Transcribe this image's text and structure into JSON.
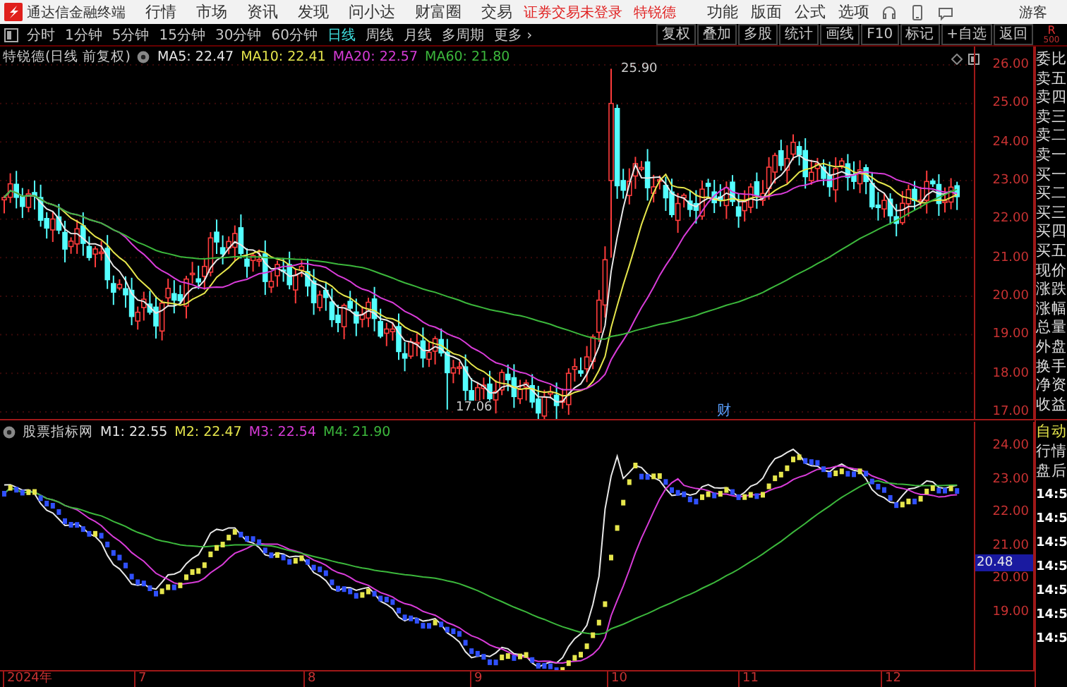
{
  "app_bar": {
    "title": "通达信金融终端",
    "menus": [
      "行情",
      "市场",
      "资讯",
      "发现",
      "问小达",
      "财富圈",
      "交易"
    ],
    "login_notice": "证券交易未登录",
    "stock_name": "特锐德",
    "tools": [
      "功能",
      "版面",
      "公式",
      "选项"
    ],
    "user": "游客"
  },
  "toolbar": {
    "periods": [
      {
        "label": "分时",
        "selected": false
      },
      {
        "label": "1分钟",
        "selected": false
      },
      {
        "label": "5分钟",
        "selected": false
      },
      {
        "label": "15分钟",
        "selected": false
      },
      {
        "label": "30分钟",
        "selected": false
      },
      {
        "label": "60分钟",
        "selected": false
      },
      {
        "label": "日线",
        "selected": true
      },
      {
        "label": "周线",
        "selected": false
      },
      {
        "label": "月线",
        "selected": false
      },
      {
        "label": "多周期",
        "selected": false
      },
      {
        "label": "更多 ›",
        "selected": false
      }
    ],
    "actions": [
      "复权",
      "叠加",
      "多股",
      "统计",
      "画线",
      "F10",
      "标记",
      "+自选",
      "返回"
    ],
    "corner": [
      "R",
      "500"
    ]
  },
  "main_chart": {
    "title": "特锐德(日线 前复权)",
    "indicators": [
      {
        "label": "MA5: 22.47",
        "color": "#e8e8e8"
      },
      {
        "label": "MA10: 22.41",
        "color": "#e6e64c"
      },
      {
        "label": "MA20: 22.57",
        "color": "#d93cd9"
      },
      {
        "label": "MA60: 21.80",
        "color": "#3cb83c"
      }
    ],
    "y_axis": [
      "26.00",
      "25.00",
      "24.00",
      "23.00",
      "22.00",
      "21.00",
      "20.00",
      "19.00",
      "18.00",
      "17.00"
    ],
    "high_label": "25.90",
    "low_label": "17.06",
    "marker": "财"
  },
  "sub_chart": {
    "title": "股票指标网",
    "indicators": [
      {
        "label": "M1: 22.55",
        "color": "#e8e8e8"
      },
      {
        "label": "M2: 22.47",
        "color": "#e6e64c"
      },
      {
        "label": "M3: 22.54",
        "color": "#d93cd9"
      },
      {
        "label": "M4: 21.90",
        "color": "#3cb83c"
      }
    ],
    "y_axis": [
      "24.00",
      "23.00",
      "22.00",
      "21.00",
      "20.00",
      "19.00"
    ],
    "cursor_value": "20.48"
  },
  "x_axis": [
    "2024年",
    "7",
    "8",
    "9",
    "10",
    "11",
    "12"
  ],
  "side_panel": {
    "quote_labels": [
      "委比",
      "卖五",
      "卖四",
      "卖三",
      "卖二",
      "卖一",
      "买一",
      "买二",
      "买三",
      "买四",
      "买五",
      "现价",
      "涨跌",
      "涨幅",
      "总量",
      "外盘",
      "换手",
      "净资",
      "收益"
    ],
    "tabs": [
      {
        "label": "自动",
        "selected": true
      },
      {
        "label": "行情",
        "selected": false
      },
      {
        "label": "盘后",
        "selected": false
      }
    ],
    "times": [
      "14:5",
      "14:5",
      "14:5",
      "14:5",
      "14:5",
      "14:5",
      "14:5"
    ]
  }
}
